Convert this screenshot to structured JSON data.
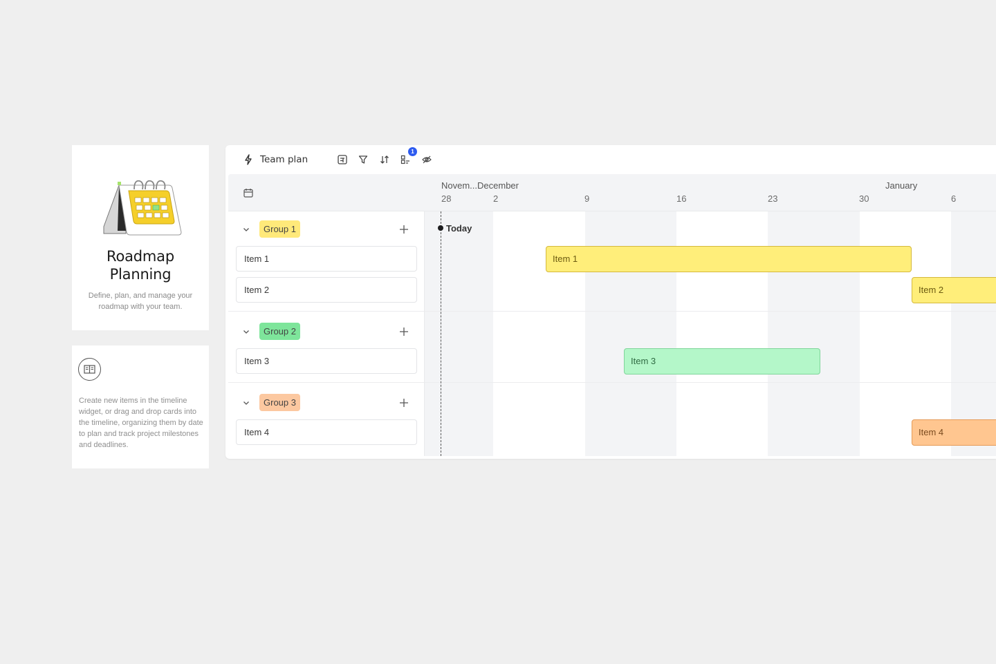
{
  "intro_card": {
    "title_line1": "Roadmap",
    "title_line2": "Planning",
    "description": "Define, plan, and manage your roadmap with your team.",
    "icon": "calendar-illustration"
  },
  "tip_card": {
    "icon": "book-icon",
    "description": "Create new items in the timeline widget, or drag and drop cards into the timeline, organizing them by date to plan and track project milestones and deadlines."
  },
  "toolbar": {
    "title": "Team plan",
    "title_icon": "bolt-icon",
    "icons": [
      "card-view-icon",
      "filter-icon",
      "sort-icon",
      "group-by-icon",
      "hide-icon"
    ],
    "group_badge_count": "1"
  },
  "timeline_header": {
    "calendar_icon": "calendar-icon",
    "months": [
      {
        "label": "Novem...December"
      },
      {
        "label": "January"
      }
    ],
    "days": [
      "28",
      "2",
      "9",
      "16",
      "23",
      "30",
      "6"
    ],
    "today_label": "Today"
  },
  "colors": {
    "yellow_fill": "#ffee7a",
    "yellow_border": "#d4b83c",
    "yellow_tag": "#ffe97a",
    "green_fill": "#b4f7c9",
    "green_border": "#7fd59a",
    "green_tag": "#7ee59b",
    "orange_fill": "#ffc690",
    "orange_border": "#e59a56",
    "orange_tag": "#fcc8a0"
  },
  "groups": [
    {
      "label": "Group 1",
      "items": [
        {
          "label": "Item 1",
          "bar_label": "Item 1"
        },
        {
          "label": "Item 2",
          "bar_label": "Item 2"
        }
      ]
    },
    {
      "label": "Group 2",
      "items": [
        {
          "label": "Item 3",
          "bar_label": "Item 3"
        }
      ]
    },
    {
      "label": "Group 3",
      "items": [
        {
          "label": "Item 4",
          "bar_label": "Item 4"
        }
      ]
    }
  ]
}
